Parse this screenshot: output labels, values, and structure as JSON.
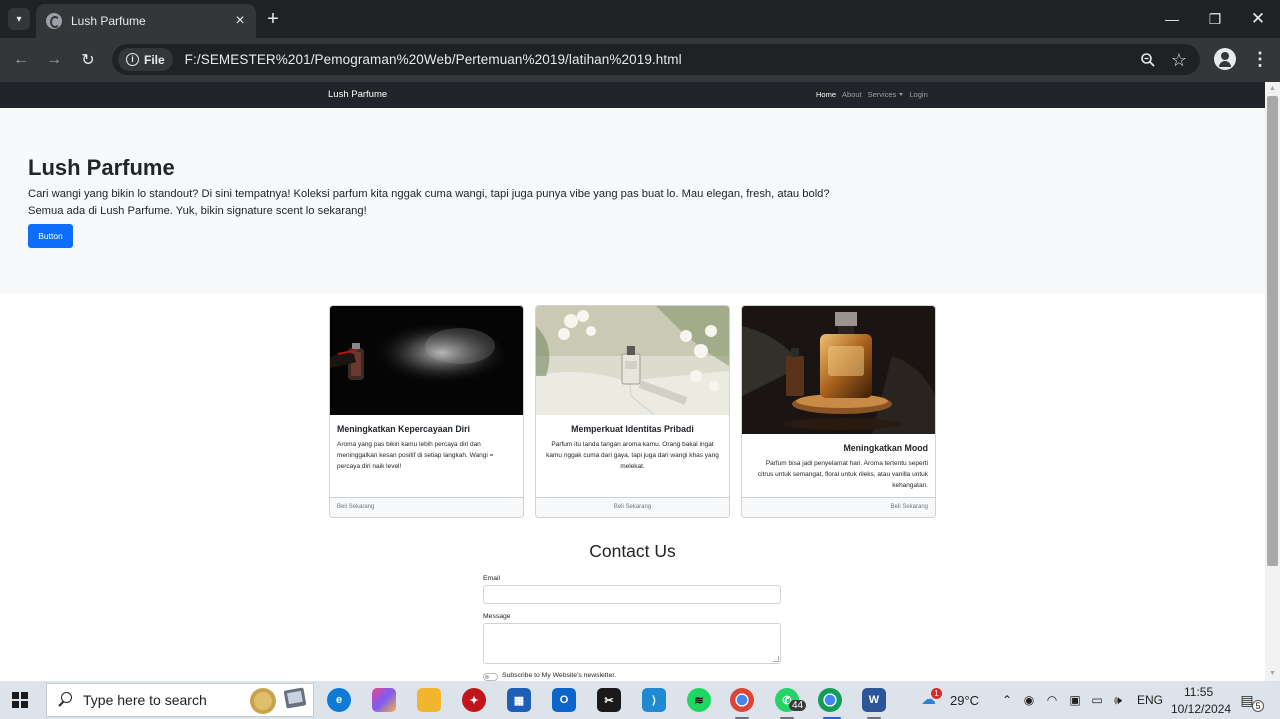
{
  "browser": {
    "tab_title": "Lush Parfume",
    "url_chip": "File",
    "url": "F:/SEMESTER%201/Pemograman%20Web/Pertemuan%2019/latihan%2019.html"
  },
  "site": {
    "brand": "Lush Parfume",
    "nav": {
      "home": "Home",
      "about": "About",
      "services": "Services",
      "login": "Login"
    },
    "hero": {
      "title": "Lush Parfume",
      "text": "Cari wangi yang bikin lo standout? Di sini tempatnya! Koleksi parfum kita nggak cuma wangi, tapi juga punya vibe yang pas buat lo. Mau elegan, fresh, atau bold? Semua ada di Lush Parfume. Yuk, bikin signature scent lo sekarang!",
      "button": "Button"
    },
    "cards": [
      {
        "title": "Meningkatkan Kepercayaan Diri",
        "text": "Aroma yang pas bikin kamu lebih percaya diri dan meninggalkan kesan positif di setiap langkah. Wangi = percaya diri naik level!",
        "footer": "Beli Sekarang"
      },
      {
        "title": "Memperkuat Identitas Pribadi",
        "text": "Parfum itu tanda tangan aroma kamu. Orang bakal ingat kamu nggak cuma dari gaya, tapi juga dari wangi khas yang melekat.",
        "footer": "Beli Sekarang"
      },
      {
        "title": "Meningkatkan Mood",
        "text": "Parfum bisa jadi penyelamat hari. Aroma tertentu seperti citrus untuk semangat, floral untuk rileks, atau vanilla untuk kehangatan.",
        "footer": "Beli Sekarang"
      }
    ],
    "contact": {
      "title": "Contact Us",
      "email_label": "Email",
      "email_value": "",
      "message_label": "Message",
      "message_value": "",
      "subscribe_label": "Subscribe to My Website's newsletter."
    }
  },
  "taskbar": {
    "search_placeholder": "Type here to search",
    "whatsapp_badge": "44",
    "weather_badge": "1",
    "temperature": "29°C",
    "language": "ENG",
    "time": "11:55",
    "date": "10/12/2024",
    "notification_count": "5"
  }
}
